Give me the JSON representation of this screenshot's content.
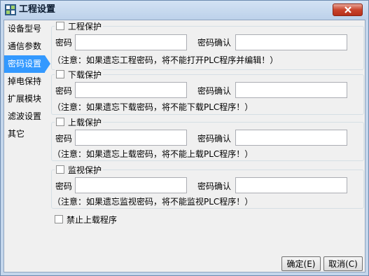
{
  "window": {
    "title": "工程设置"
  },
  "sidebar": {
    "items": [
      {
        "label": "设备型号"
      },
      {
        "label": "通信参数"
      },
      {
        "label": "密码设置",
        "active": true
      },
      {
        "label": "掉电保持"
      },
      {
        "label": "扩展模块"
      },
      {
        "label": "滤波设置"
      },
      {
        "label": "其它"
      }
    ]
  },
  "groups": [
    {
      "title": "工程保护",
      "checked": false,
      "password_label": "密码",
      "confirm_label": "密码确认",
      "password_value": "",
      "confirm_value": "",
      "note": "（注意：如果遗忘工程密码，将不能打开PLC程序并编辑！）"
    },
    {
      "title": "下载保护",
      "checked": false,
      "password_label": "密码",
      "confirm_label": "密码确认",
      "password_value": "",
      "confirm_value": "",
      "note": "（注意：如果遗忘下载密码，将不能下载PLC程序！）"
    },
    {
      "title": "上载保护",
      "checked": false,
      "password_label": "密码",
      "confirm_label": "密码确认",
      "password_value": "",
      "confirm_value": "",
      "note": "（注意：如果遗忘上载密码，将不能上载PLC程序！）"
    },
    {
      "title": "监视保护",
      "checked": false,
      "password_label": "密码",
      "confirm_label": "密码确认",
      "password_value": "",
      "confirm_value": "",
      "note": "（注意：如果遗忘监视密码，将不能监视PLC程序！）"
    }
  ],
  "forbid_upload": {
    "label": "禁止上载程序",
    "checked": false
  },
  "buttons": {
    "ok_label": "确定(E)",
    "cancel_label": "取消(C)"
  },
  "colors": {
    "accent": "#3399ff",
    "close_button": "#c9442c",
    "window_frame": "#c4d6ec"
  },
  "icons": {
    "app": "app-icon",
    "close": "close-icon"
  }
}
